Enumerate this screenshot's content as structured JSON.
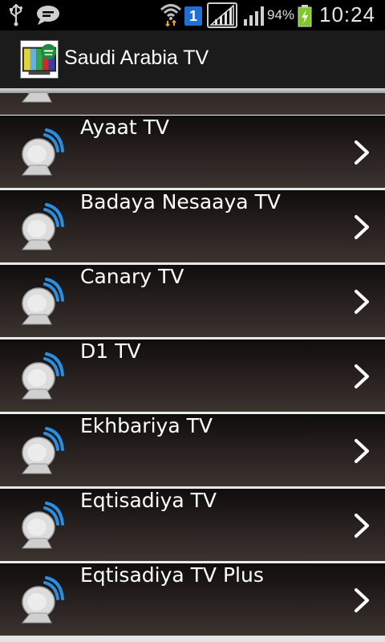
{
  "status_bar": {
    "icons": [
      "usb-icon",
      "message-icon",
      "wifi-icon",
      "sim-icon",
      "signal-icon",
      "signal-icon",
      "battery-charging-icon"
    ],
    "sim_number": "1",
    "battery_percent": "94%",
    "time": "10:24"
  },
  "action_bar": {
    "title": "Saudi Arabia TV",
    "icon": "app-tv-flag-icon"
  },
  "channels": {
    "items": [
      {
        "label": "",
        "icon": "satellite-dish-icon"
      },
      {
        "label": "Ayaat TV",
        "icon": "satellite-dish-icon"
      },
      {
        "label": "Badaya Nesaaya TV",
        "icon": "satellite-dish-icon"
      },
      {
        "label": "Canary TV",
        "icon": "satellite-dish-icon"
      },
      {
        "label": "D1 TV",
        "icon": "satellite-dish-icon"
      },
      {
        "label": "Ekhbariya TV",
        "icon": "satellite-dish-icon"
      },
      {
        "label": "Eqtisadiya TV",
        "icon": "satellite-dish-icon"
      },
      {
        "label": "Eqtisadiya TV Plus",
        "icon": "satellite-dish-icon"
      }
    ],
    "chevron_icon": "chevron-right-icon"
  },
  "colors": {
    "wifi_accent": "#f0a030",
    "sim_badge": "#1f6fd6",
    "battery_charge": "#7ec82a",
    "dish_wave": "#2a8fe0"
  }
}
